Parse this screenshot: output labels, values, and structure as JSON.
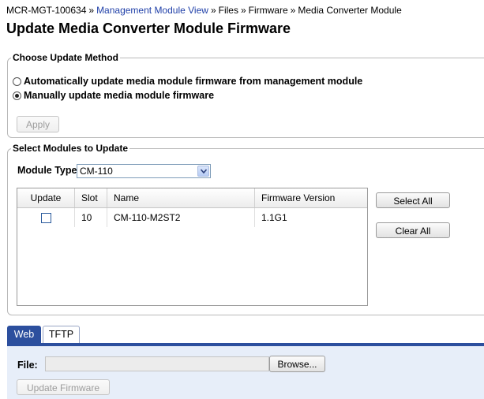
{
  "breadcrumb": {
    "items": [
      {
        "label": "MCR-MGT-100634",
        "link": false
      },
      {
        "label": "Management Module View",
        "link": true
      },
      {
        "label": "Files",
        "link": false
      },
      {
        "label": "Firmware",
        "link": false
      },
      {
        "label": "Media Converter Module",
        "link": false
      }
    ],
    "separator": "»"
  },
  "page_title": "Update Media Converter Module Firmware",
  "update_method": {
    "legend": "Choose Update Method",
    "options": [
      {
        "label": "Automatically update media module firmware from management module",
        "selected": false
      },
      {
        "label": "Manually update media module firmware",
        "selected": true
      }
    ],
    "apply_label": "Apply"
  },
  "modules": {
    "legend": "Select Modules to Update",
    "module_type_label": "Module Type:",
    "module_type_value": "CM-110",
    "table": {
      "headers": [
        "Update",
        "Slot",
        "Name",
        "Firmware Version"
      ],
      "rows": [
        {
          "checked": false,
          "slot": "10",
          "name": "CM-110-M2ST2",
          "firmware": "1.1G1"
        }
      ]
    },
    "select_all_label": "Select All",
    "clear_all_label": "Clear All"
  },
  "tabs": [
    {
      "label": "Web",
      "active": true
    },
    {
      "label": "TFTP",
      "active": false
    }
  ],
  "upload": {
    "file_label": "File:",
    "file_value": "",
    "browse_label": "Browse...",
    "update_label": "Update Firmware"
  },
  "colors": {
    "link": "#1f3fa8",
    "tab_active": "#2c4f9e",
    "panel_bg": "#e7eef9"
  }
}
